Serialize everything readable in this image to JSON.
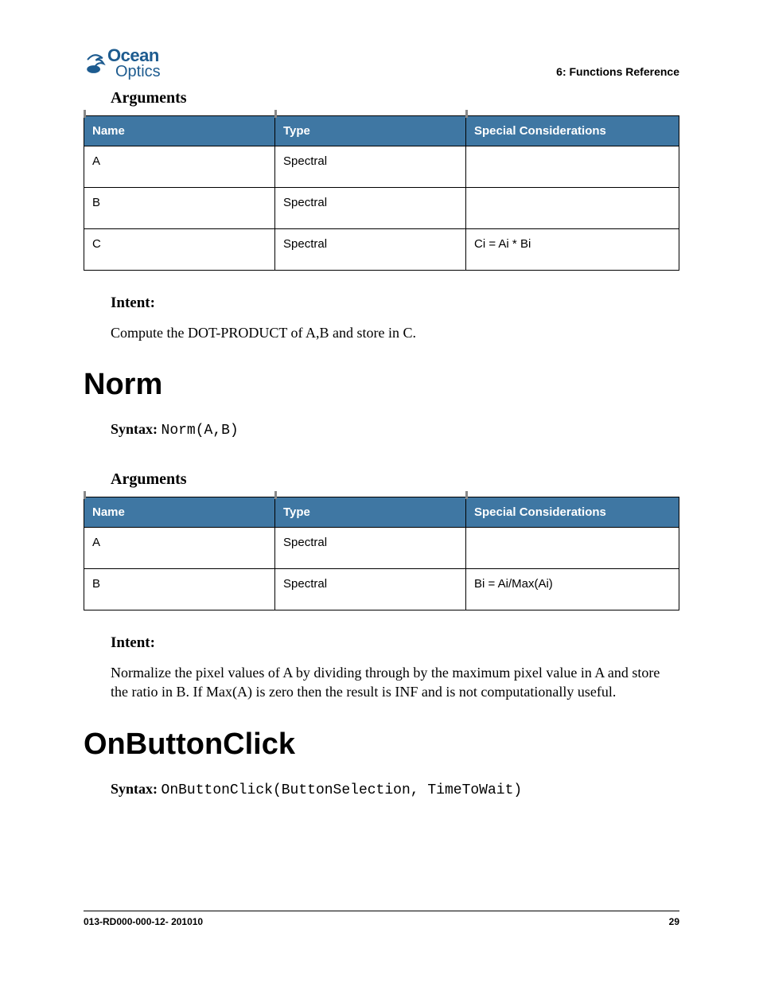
{
  "logo": {
    "top": "Ocean",
    "bottom": "Optics"
  },
  "chapterRef": "6: Functions Reference",
  "section1": {
    "argumentsHeading": "Arguments",
    "headers": [
      "Name",
      "Type",
      "Special Considerations"
    ],
    "rows": [
      {
        "name": "A",
        "type": "Spectral",
        "spec": ""
      },
      {
        "name": "B",
        "type": "Spectral",
        "spec": ""
      },
      {
        "name": "C",
        "type": "Spectral",
        "spec": "Ci = Ai * Bi"
      }
    ],
    "intentHeading": "Intent:",
    "intentBody": "Compute the DOT-PRODUCT of A,B and store in C."
  },
  "norm": {
    "title": "Norm",
    "syntaxLabel": "Syntax:",
    "syntaxCode": "Norm(A,B)",
    "argumentsHeading": "Arguments",
    "headers": [
      "Name",
      "Type",
      "Special Considerations"
    ],
    "rows": [
      {
        "name": "A",
        "type": "Spectral",
        "spec": ""
      },
      {
        "name": "B",
        "type": "Spectral",
        "spec": "Bi = Ai/Max(Ai)"
      }
    ],
    "intentHeading": "Intent:",
    "intentBody": "Normalize the pixel values of A by dividing through by the maximum pixel value in A and store the ratio in B. If Max(A) is zero then the result is INF and is not computationally useful."
  },
  "onButtonClick": {
    "title": "OnButtonClick",
    "syntaxLabel": "Syntax:",
    "syntaxCode": "OnButtonClick(ButtonSelection, TimeToWait)"
  },
  "footer": {
    "docId": "013-RD000-000-12- 201010",
    "pageNum": "29"
  }
}
